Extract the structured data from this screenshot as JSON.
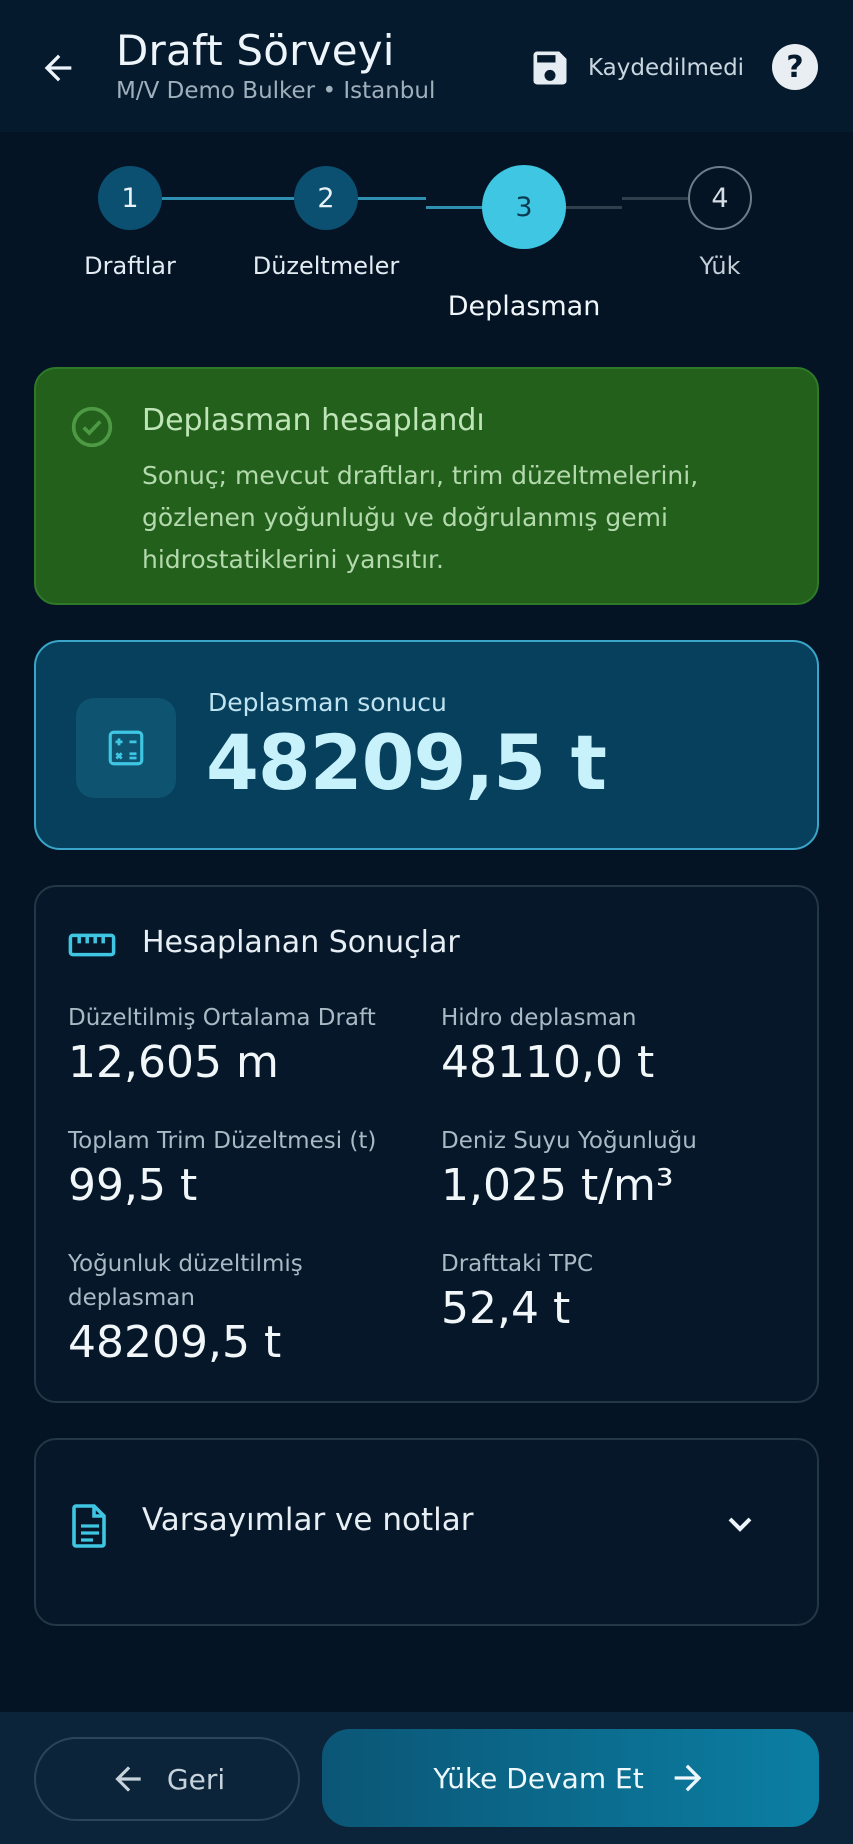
{
  "header": {
    "title": "Draft Sörveyi",
    "subtitle": "M/V Demo Bulker • Istanbul",
    "save_status": "Kaydedilmedi",
    "help_glyph": "?"
  },
  "stepper": {
    "steps": [
      {
        "number": "1",
        "label": "Draftlar",
        "state": "done"
      },
      {
        "number": "2",
        "label": "Düzeltmeler",
        "state": "done"
      },
      {
        "number": "3",
        "label": "Deplasman",
        "state": "active"
      },
      {
        "number": "4",
        "label": "Yük",
        "state": "pending"
      }
    ]
  },
  "success_banner": {
    "title": "Deplasman hesaplandı",
    "message": "Sonuç; mevcut draftları, trim düzeltmelerini, gözlenen yoğunluğu ve doğrulanmış gemi hidrostatiklerini yansıtır."
  },
  "result": {
    "label": "Deplasman sonucu",
    "value": "48209,5 t"
  },
  "computed": {
    "title": "Hesaplanan Sonuçlar",
    "metrics": [
      {
        "label": "Düzeltilmiş Ortalama Draft",
        "value": "12,605 m"
      },
      {
        "label": "Hidro deplasman",
        "value": "48110,0 t"
      },
      {
        "label": "Toplam Trim Düzeltmesi (t)",
        "value": "99,5 t"
      },
      {
        "label": "Deniz Suyu Yoğunluğu",
        "value": "1,025 t/m³"
      },
      {
        "label": "Yoğunluk düzeltilmiş deplasman",
        "value": "48209,5 t"
      },
      {
        "label": "Drafttaki TPC",
        "value": "52,4 t"
      }
    ]
  },
  "notes": {
    "label": "Varsayımlar ve notlar"
  },
  "footer": {
    "back_label": "Geri",
    "next_label": "Yüke Devam Et"
  },
  "colors": {
    "background": "#041424",
    "accent": "#3fc6e2",
    "success": "#22601c",
    "result_card": "#07405d"
  },
  "icons": {
    "back": "arrow-left-icon",
    "save": "floppy-disk-icon",
    "help": "help-circle-icon",
    "success": "check-circle-icon",
    "calculator": "calculator-icon",
    "ruler": "ruler-icon",
    "document": "document-icon",
    "expand": "chevron-down-icon",
    "next": "arrow-right-icon"
  }
}
